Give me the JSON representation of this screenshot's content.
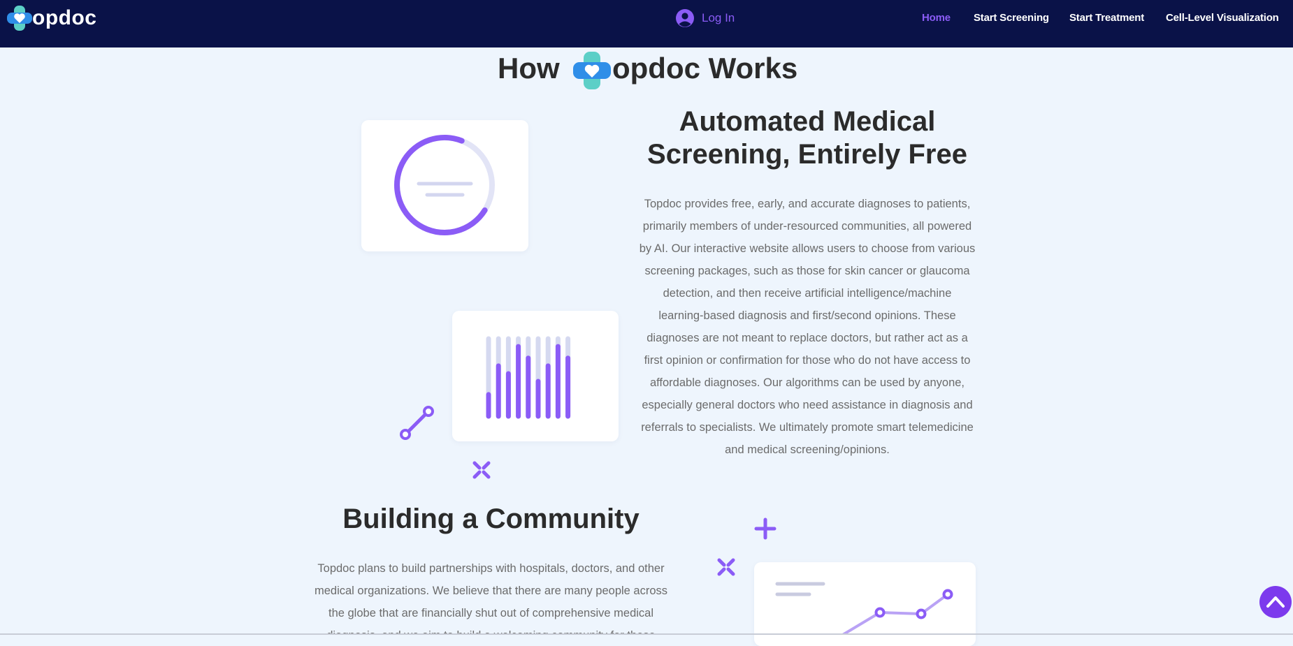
{
  "brand": {
    "logo_text": "opdoc",
    "colors": {
      "navy": "#0a1248",
      "purple": "#8b5cf6",
      "blue": "#2f8ee8",
      "teal": "#5ccfc7"
    }
  },
  "nav": {
    "login_label": "Log In",
    "links": [
      "Home",
      "Start Screening",
      "Start Treatment",
      "Cell-Level Visualization"
    ],
    "active": "Home"
  },
  "how": {
    "prefix": "How",
    "suffix": "opdoc Works"
  },
  "section1": {
    "title_line1": "Automated Medical",
    "title_line2": "Screening, Entirely Free",
    "lines": [
      "Topdoc provides free, early, and accurate diagnoses to patients,",
      "primarily members of under-resourced communities, all powered",
      "by AI. Our interactive website allows users to choose from various",
      "screening packages, such as those for skin cancer or glaucoma",
      "detection, and then receive artificial intelligence/machine",
      "learning-based diagnosis and first/second opinions. These",
      "diagnoses are not meant to replace doctors, but rather act as a",
      "first opinion or confirmation for those who do not have access to",
      "affordable diagnoses. Our algorithms can be used by anyone,",
      "especially general doctors who need assistance in diagnosis and",
      "referrals to specialists. We ultimately promote smart telemedicine",
      "and medical screening/opinions."
    ]
  },
  "section2": {
    "title": "Building a Community",
    "lines": [
      "Topdoc plans to build partnerships with hospitals, doctors, and other",
      "medical organizations. We believe that there are many people across",
      "the globe that are financially shut out of comprehensive medical",
      "diagnosis, and we aim to build a welcoming community for these"
    ]
  },
  "illustrations": {
    "donut_progress": 0.72,
    "bar_levels": [
      0.28,
      0.65,
      0.55,
      0.9,
      0.75,
      0.45,
      0.65,
      0.9,
      0.75
    ]
  }
}
